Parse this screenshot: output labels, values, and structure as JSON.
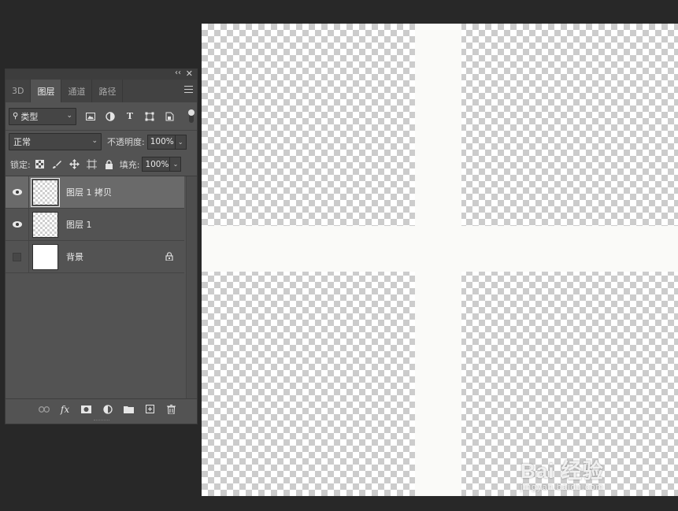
{
  "panel": {
    "collapse_glyph": "‹‹",
    "close_glyph": "✕",
    "tabs": [
      {
        "label": "3D"
      },
      {
        "label": "图层"
      },
      {
        "label": "通道"
      },
      {
        "label": "路径"
      }
    ],
    "filter": {
      "kind_label": "类型",
      "icons": [
        "image-filter-icon",
        "adjustment-filter-icon",
        "type-filter-icon",
        "shape-filter-icon",
        "smart-object-filter-icon"
      ]
    },
    "blend": {
      "mode": "正常",
      "opacity_label": "不透明度:",
      "opacity_value": "100%"
    },
    "lock": {
      "label": "锁定:",
      "fill_label": "填充:",
      "fill_value": "100%"
    },
    "layers": [
      {
        "name": "图层 1 拷贝",
        "visible": true,
        "selected": true,
        "thumb": "transparent"
      },
      {
        "name": "图层 1",
        "visible": true,
        "selected": false,
        "thumb": "transparent"
      },
      {
        "name": "背景",
        "visible": false,
        "selected": false,
        "thumb": "white",
        "locked": true
      }
    ],
    "bottom_icons": [
      "link-icon",
      "fx-icon",
      "mask-icon",
      "adjustment-layer-icon",
      "folder-icon",
      "new-layer-icon",
      "trash-icon"
    ],
    "fx_label": "fx"
  },
  "canvas": {
    "watermark_main": "Bai 经验",
    "watermark_sub": "jingyan.baidu.com"
  },
  "colors": {
    "app_bg": "#282828",
    "panel_bg": "#535353",
    "selected_row": "#6a6a6a",
    "cross": "#fafaf8"
  }
}
